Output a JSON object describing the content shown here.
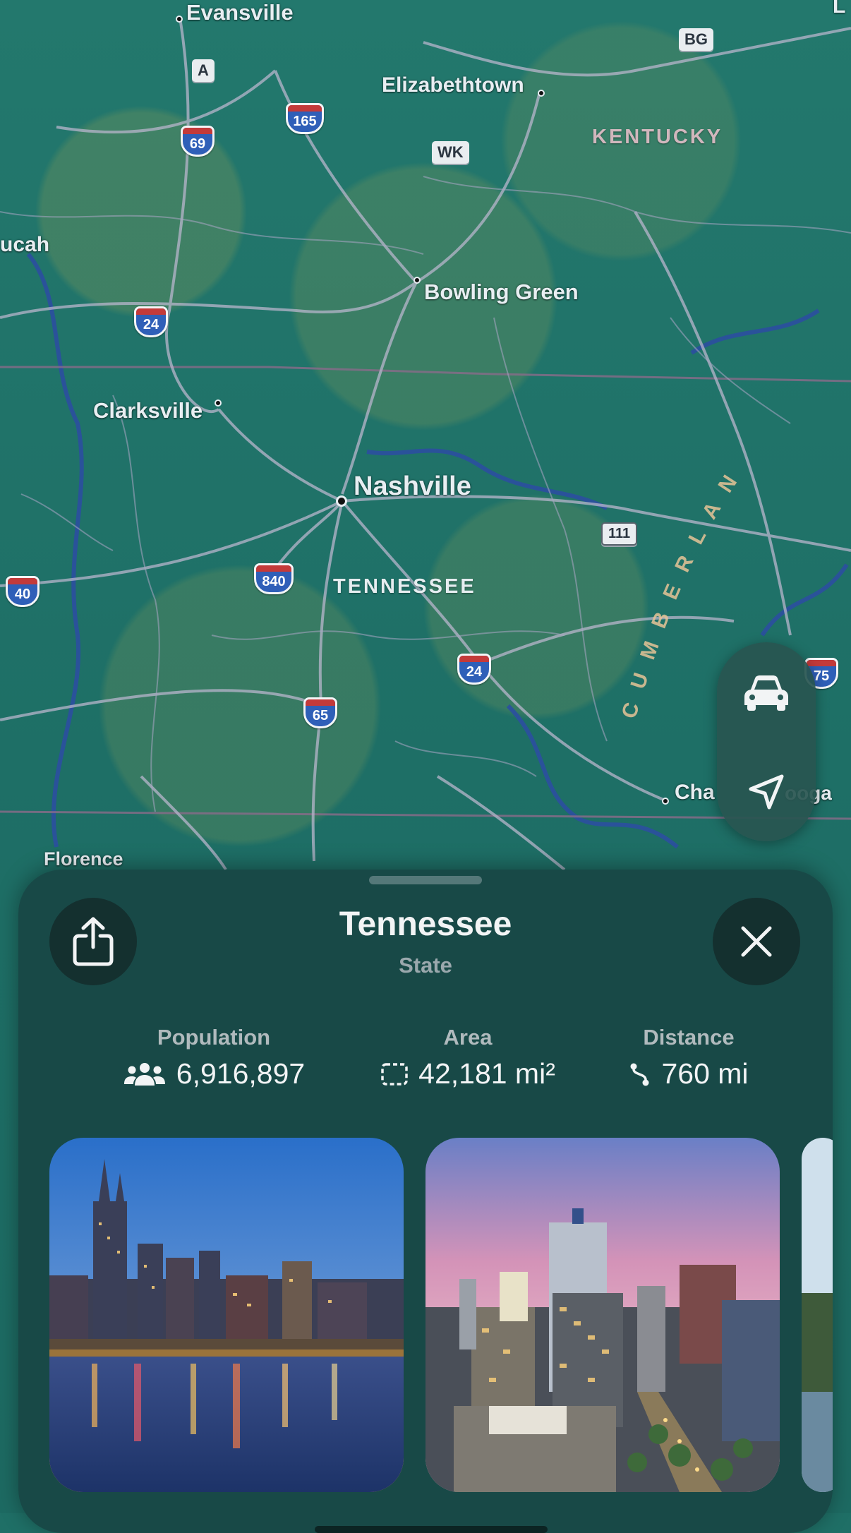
{
  "map": {
    "cities": [
      {
        "id": "evansville",
        "label": "Evansville"
      },
      {
        "id": "elizabethtown",
        "label": "Elizabethtown"
      },
      {
        "id": "paducah",
        "label": "ucah"
      },
      {
        "id": "bowling-green",
        "label": "Bowling Green"
      },
      {
        "id": "clarksville",
        "label": "Clarksville"
      },
      {
        "id": "nashville",
        "label": "Nashville"
      },
      {
        "id": "florence",
        "label": "Florence"
      },
      {
        "id": "chattanooga",
        "label": "Cha"
      },
      {
        "id": "chattanooga-tail",
        "label": "ooga"
      },
      {
        "id": "top-right",
        "label": "L"
      }
    ],
    "state_labels": [
      {
        "id": "kentucky",
        "label": "KENTUCKY"
      },
      {
        "id": "tennessee",
        "label": "TENNESSEE"
      }
    ],
    "region_label": "CUMBERLAN",
    "interstates": [
      "69",
      "165",
      "24",
      "40",
      "840",
      "24",
      "65",
      "75"
    ],
    "signs": [
      "A",
      "WK",
      "BG",
      "111"
    ],
    "colors": {
      "land": "#1f6f66",
      "road": "#b8b6cc",
      "water": "#2b4fa0",
      "interstate": "#2f5fb8"
    }
  },
  "controls": {
    "drive_icon": "car-icon",
    "location_icon": "location-arrow-icon"
  },
  "card": {
    "title": "Tennessee",
    "subtitle": "State",
    "share_icon": "share-icon",
    "close_icon": "close-icon",
    "stats": [
      {
        "label": "Population",
        "value": "6,916,897",
        "icon": "people-icon"
      },
      {
        "label": "Area",
        "value": "42,181 mi²",
        "icon": "area-icon"
      },
      {
        "label": "Distance",
        "value": "760 mi",
        "icon": "route-icon"
      }
    ],
    "photos": [
      {
        "name": "nashville-skyline-photo"
      },
      {
        "name": "memphis-skyline-photo"
      },
      {
        "name": "third-photo"
      }
    ]
  }
}
